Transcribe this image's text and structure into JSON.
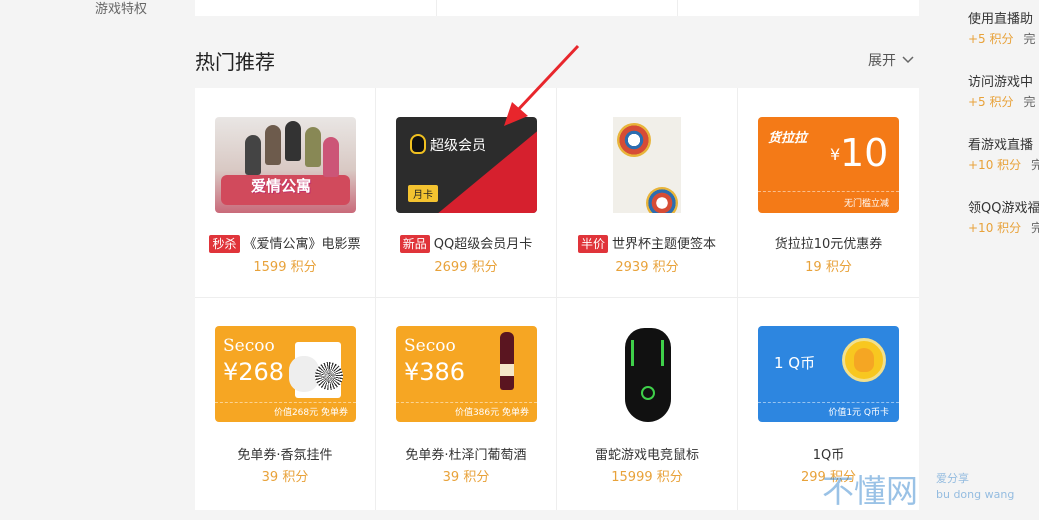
{
  "left_nav": {
    "item": "游戏特权"
  },
  "section": {
    "title": "热门推荐",
    "expand_label": "展开"
  },
  "products": [
    {
      "tag": "秒杀",
      "title": "《爱情公寓》电影票",
      "points": "1599 积分",
      "thumb_text": "爱情公寓"
    },
    {
      "tag": "新品",
      "title": "QQ超级会员月卡",
      "points": "2699 积分",
      "thumb_text": "超级会员",
      "thumb_badge": "月卡"
    },
    {
      "tag": "半价",
      "title": "世界杯主题便签本",
      "points": "2939 积分"
    },
    {
      "title": "货拉拉10元优惠券",
      "points": "19 积分",
      "thumb_brand": "货拉拉",
      "thumb_amount": "10",
      "thumb_yen": "¥",
      "thumb_foot": "无门槛立减"
    },
    {
      "title": "免单券·香氛挂件",
      "points": "39 积分",
      "thumb_brand": "Secoo",
      "thumb_amount": "¥268",
      "thumb_foot": "价值268元 免单券"
    },
    {
      "title": "免单券·杜泽门葡萄酒",
      "points": "39 积分",
      "thumb_brand": "Secoo",
      "thumb_amount": "¥386",
      "thumb_foot": "价值386元 免单券"
    },
    {
      "title": "雷蛇游戏电竞鼠标",
      "points": "15999 积分"
    },
    {
      "title": "1Q币",
      "points": "299 积分",
      "thumb_label": "1 Q币",
      "thumb_foot": "价值1元 Q币卡"
    }
  ],
  "tasks": [
    {
      "title": "使用直播助",
      "points": "+5 积分",
      "status": "完"
    },
    {
      "title": "访问游戏中",
      "points": "+5 积分",
      "status": "完"
    },
    {
      "title": "看游戏直播",
      "points": "+10 积分",
      "status": "完"
    },
    {
      "title": "领QQ游戏福",
      "points": "+10 积分",
      "status": "完"
    }
  ],
  "watermark": {
    "main": "不懂网",
    "sub1": "爱分享",
    "sub2": "bu dong wang"
  },
  "colors": {
    "accent": "#e8a23a",
    "tag_red": "#e0343a",
    "arrow_red": "#e8262c"
  }
}
